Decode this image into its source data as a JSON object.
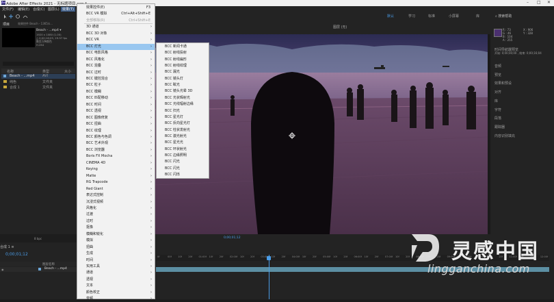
{
  "app": {
    "title": "Adobe After Effects 2021 - 无标题项目.aep *",
    "icon_text": "Ae",
    "window_controls": [
      "–",
      "□",
      "✕"
    ]
  },
  "menubar": [
    "文件(F)",
    "编辑(E)",
    "合成(C)",
    "图层(L)",
    "效果(T)"
  ],
  "workspaces": {
    "default": "默认",
    "learn": "学习",
    "standard": "标准",
    "small_screen": "小屏幕",
    "libraries": "库"
  },
  "search_help": "搜索帮助",
  "project": {
    "tab": "项目",
    "tab2": "效果控件 Beach - 1365/s...",
    "file_name": "Beach - ...mp4 ▾",
    "info_lines": [
      "1920 x 1080 (1.00)",
      "△ 0;00;16;05, 29.97 fps",
      "数百万种颜色",
      "H.264"
    ],
    "columns": {
      "name": "名称",
      "type": "类型",
      "size": "大小"
    },
    "rows": [
      {
        "name": "Beach - ...mp4",
        "type": "AVI",
        "size": ""
      },
      {
        "name": "纯色",
        "type": "文件夹",
        "size": ""
      },
      {
        "name": "合成 1",
        "type": "文件夹",
        "size": ""
      }
    ],
    "bpc": "8 bpc"
  },
  "effects_menu": {
    "items": [
      {
        "label": "效果控件(E)",
        "shortcut": "F3",
        "disabled": false,
        "arrow": false
      },
      {
        "label": "BCC VR 模拟",
        "shortcut": "Ctrl+Alt+Shift+E",
        "disabled": false,
        "arrow": false
      },
      {
        "label": "全部移除(R)",
        "shortcut": "Ctrl+Shift+E",
        "disabled": true,
        "arrow": false
      },
      {
        "label": "3D 通道",
        "shortcut": "",
        "disabled": false,
        "arrow": true
      },
      {
        "label": "BCC 3D 对象",
        "shortcut": "",
        "disabled": false,
        "arrow": true
      },
      {
        "label": "BCC VR",
        "shortcut": "",
        "disabled": false,
        "arrow": true
      },
      {
        "label": "BCC 灯光",
        "shortcut": "",
        "disabled": false,
        "arrow": true,
        "selected": true
      },
      {
        "label": "BCC 电影风格",
        "shortcut": "",
        "disabled": false,
        "arrow": true
      },
      {
        "label": "BCC 风格化",
        "shortcut": "",
        "disabled": false,
        "arrow": true
      },
      {
        "label": "BCC 混叠",
        "shortcut": "",
        "disabled": false,
        "arrow": true
      },
      {
        "label": "BCC 过时",
        "shortcut": "",
        "disabled": false,
        "arrow": true
      },
      {
        "label": "BCC 键控混合",
        "shortcut": "",
        "disabled": false,
        "arrow": true
      },
      {
        "label": "BCC 粒子",
        "shortcut": "",
        "disabled": false,
        "arrow": true
      },
      {
        "label": "BCC 模糊",
        "shortcut": "",
        "disabled": false,
        "arrow": true
      },
      {
        "label": "BCC 匹配移动",
        "shortcut": "",
        "disabled": false,
        "arrow": true
      },
      {
        "label": "BCC 时间",
        "shortcut": "",
        "disabled": false,
        "arrow": true
      },
      {
        "label": "BCC 透视",
        "shortcut": "",
        "disabled": false,
        "arrow": true
      },
      {
        "label": "BCC 图像修复",
        "shortcut": "",
        "disabled": false,
        "arrow": true
      },
      {
        "label": "BCC 扭曲",
        "shortcut": "",
        "disabled": false,
        "arrow": true
      },
      {
        "label": "BCC 纹理",
        "shortcut": "",
        "disabled": false,
        "arrow": true
      },
      {
        "label": "BCC 颜色与色调",
        "shortcut": "",
        "disabled": false,
        "arrow": true
      },
      {
        "label": "BCC 艺术外观",
        "shortcut": "",
        "disabled": false,
        "arrow": true
      },
      {
        "label": "BCC 浏览器",
        "shortcut": "",
        "disabled": false,
        "arrow": true
      },
      {
        "label": "Boris FX Mocha",
        "shortcut": "",
        "disabled": false,
        "arrow": true
      },
      {
        "label": "CINEMA 4D",
        "shortcut": "",
        "disabled": false,
        "arrow": true
      },
      {
        "label": "Keying",
        "shortcut": "",
        "disabled": false,
        "arrow": true
      },
      {
        "label": "Matte",
        "shortcut": "",
        "disabled": false,
        "arrow": true
      },
      {
        "label": "RG Trapcode",
        "shortcut": "",
        "disabled": false,
        "arrow": true
      },
      {
        "label": "Red Giant",
        "shortcut": "",
        "disabled": false,
        "arrow": true
      },
      {
        "label": "表达式控制",
        "shortcut": "",
        "disabled": false,
        "arrow": true
      },
      {
        "label": "沉浸式视频",
        "shortcut": "",
        "disabled": false,
        "arrow": true
      },
      {
        "label": "风格化",
        "shortcut": "",
        "disabled": false,
        "arrow": true
      },
      {
        "label": "过渡",
        "shortcut": "",
        "disabled": false,
        "arrow": true
      },
      {
        "label": "过时",
        "shortcut": "",
        "disabled": false,
        "arrow": true
      },
      {
        "label": "抠像",
        "shortcut": "",
        "disabled": false,
        "arrow": true
      },
      {
        "label": "模糊和锐化",
        "shortcut": "",
        "disabled": false,
        "arrow": true
      },
      {
        "label": "模拟",
        "shortcut": "",
        "disabled": false,
        "arrow": true
      },
      {
        "label": "扭曲",
        "shortcut": "",
        "disabled": false,
        "arrow": true
      },
      {
        "label": "生成",
        "shortcut": "",
        "disabled": false,
        "arrow": true
      },
      {
        "label": "时间",
        "shortcut": "",
        "disabled": false,
        "arrow": true
      },
      {
        "label": "实用工具",
        "shortcut": "",
        "disabled": false,
        "arrow": true
      },
      {
        "label": "通道",
        "shortcut": "",
        "disabled": false,
        "arrow": true
      },
      {
        "label": "透视",
        "shortcut": "",
        "disabled": false,
        "arrow": true
      },
      {
        "label": "文本",
        "shortcut": "",
        "disabled": false,
        "arrow": true
      },
      {
        "label": "颜色校正",
        "shortcut": "",
        "disabled": false,
        "arrow": true
      },
      {
        "label": "音频",
        "shortcut": "",
        "disabled": false,
        "arrow": true
      }
    ]
  },
  "bcc_light_submenu": [
    "BCC 新闻卡通",
    "BCC 射线投射",
    "BCC 射线扁形",
    "BCC 射线纹理",
    "BCC 漏光",
    "BCC 镜头灯",
    "BCC 眩光",
    "BCC 镜头光晕 3D",
    "BCC 光状辉射光",
    "BCC 光线辐射边缘",
    "BCC 扫光",
    "BCC 星光灯",
    "BCC 反向星光灯",
    "BCC 柱状发射光",
    "BCC 激光射光",
    "BCC 星光光",
    "BCC 环状射光",
    "BCC 边缘照明",
    "BCC 闪光",
    "BCC 闪光",
    "BCC 闪烁"
  ],
  "viewer": {
    "tab": "合成 合成 1 ≡",
    "tab2": "图层 (无)",
    "tab3": "素材 (无)",
    "zoom": "(50%)",
    "timecode": "0;00;01;12",
    "quality": "完整"
  },
  "right_panel": {
    "info_values": [
      "R : 73",
      "G : 46",
      "B : 104",
      "A : 255"
    ],
    "xy": [
      "X : 906",
      "Y : 328"
    ],
    "preview_header": "时间导航器预览",
    "preview_values": "开始: 0;00;00;00 , 结束: 0;00;16;04",
    "sections": [
      "音频",
      "预览",
      "效果和预设",
      "对齐",
      "库",
      "字符",
      "段落",
      "跟踪器",
      "内容识别填充"
    ]
  },
  "timeline": {
    "tab": "合成 1 ≡",
    "timecode": "0;00;01;12",
    "layer_header": "图层名称",
    "layer_name": "Beach - ...mp4",
    "ruler_ticks": [
      "0f",
      "00f",
      "10f",
      "20f",
      "01:00f",
      "10f",
      "20f",
      "02:00f",
      "10f",
      "20f",
      "03:00f",
      "10f",
      "20f",
      "04:00f",
      "10f",
      "20f",
      "05:00f",
      "10f",
      "20f",
      "06:00f",
      "10f",
      "20f",
      "07:00f",
      "10f",
      "20f",
      "08:00f",
      "10f",
      "20f",
      "09:00f",
      "10f",
      "20f",
      "10:00f",
      "10f",
      "20f",
      "11:00f",
      "10f",
      "20f",
      "12:00f"
    ]
  },
  "watermark": {
    "cn": "灵感中国",
    "url": "lingganchina.com"
  },
  "colors": {
    "accent": "#4a9de8",
    "menu_highlight": "#99c7f0",
    "panel_bg": "#232323"
  }
}
